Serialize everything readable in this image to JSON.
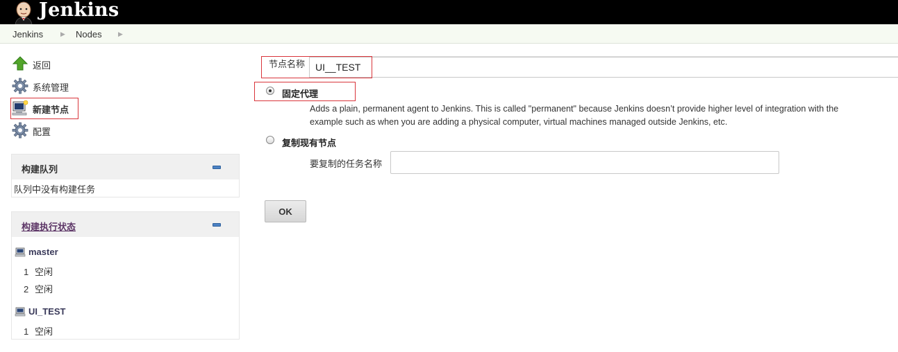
{
  "header": {
    "title": "Jenkins",
    "logo_icon": "jenkins-butler-icon"
  },
  "breadcrumb": {
    "items": [
      "Jenkins",
      "Nodes"
    ]
  },
  "tasks": [
    {
      "label": "返回",
      "icon": "up-arrow-icon"
    },
    {
      "label": "系统管理",
      "icon": "gear-icon"
    },
    {
      "label": "新建节点",
      "icon": "new-computer-icon"
    },
    {
      "label": "配置",
      "icon": "gear-icon"
    }
  ],
  "build_queue": {
    "title": "构建队列",
    "empty_text": "队列中没有构建任务"
  },
  "executor_status": {
    "title": "构建执行状态",
    "computers": [
      {
        "name": "master",
        "executors": [
          {
            "num": "1",
            "state": "空闲"
          },
          {
            "num": "2",
            "state": "空闲"
          }
        ]
      },
      {
        "name": "UI_TEST",
        "executors": [
          {
            "num": "1",
            "state": "空闲"
          }
        ]
      }
    ]
  },
  "form": {
    "name_label": "节点名称",
    "name_value": "UI__TEST",
    "option_permanent": {
      "label": "固定代理",
      "selected": true,
      "desc_line1": "Adds a plain, permanent agent to Jenkins. This is called \"permanent\" because Jenkins doesn’t provide higher level of integration with the",
      "desc_line2": "example such as when you are adding a physical computer, virtual machines managed outside Jenkins, etc."
    },
    "option_copy": {
      "label": "复制现有节点",
      "selected": false,
      "copy_from_label": "要复制的任务名称",
      "copy_from_value": ""
    },
    "ok_label": "OK"
  },
  "colors": {
    "highlight_box": "#d9343a",
    "header_bg": "#000000",
    "breadcrumb_bg": "#f6faf2"
  }
}
